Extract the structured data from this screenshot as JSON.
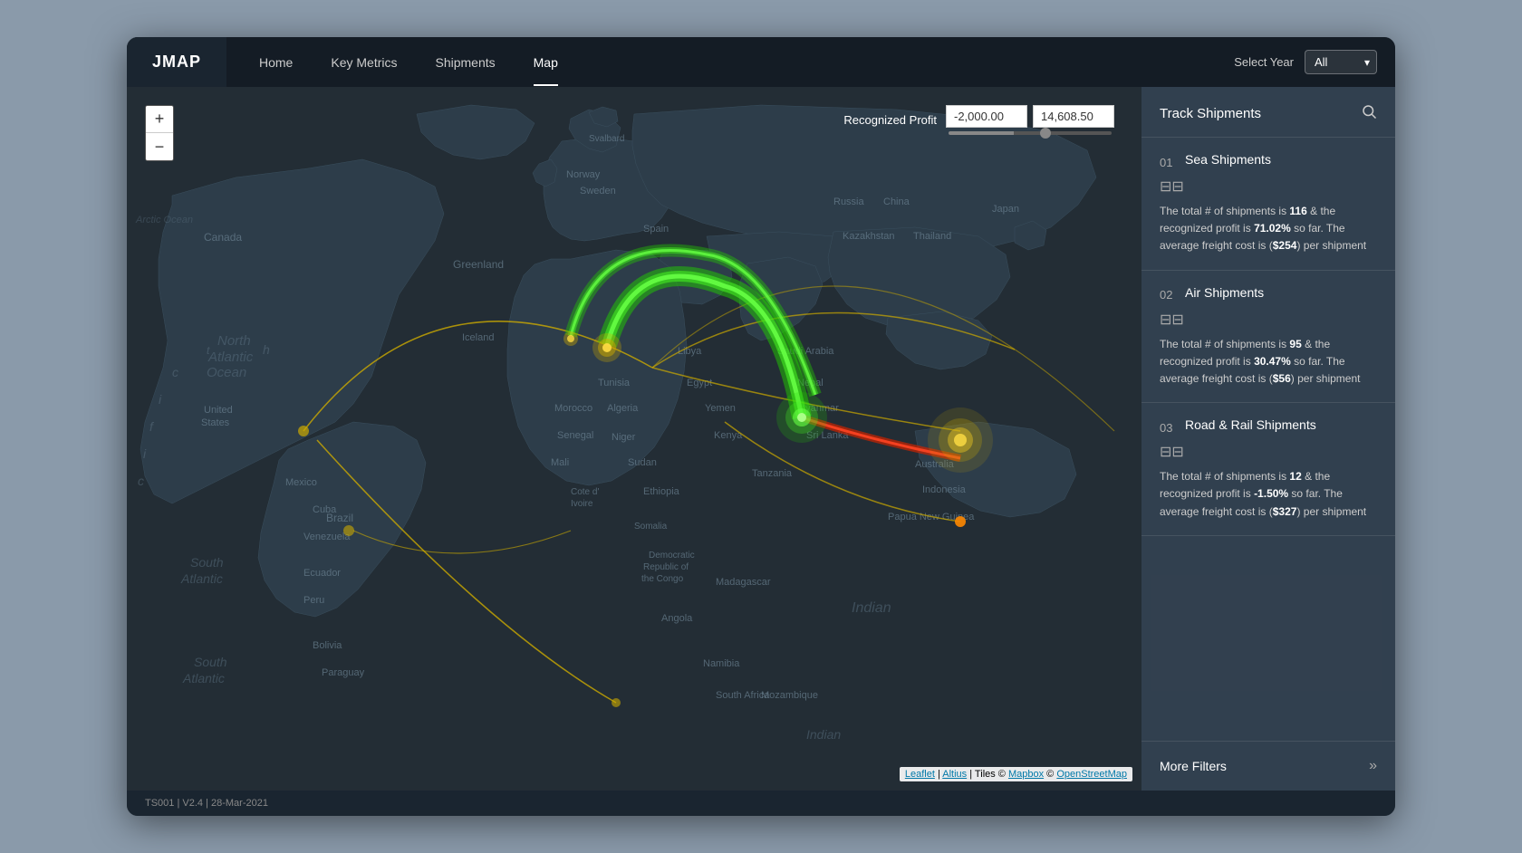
{
  "app": {
    "logo": "JMAP",
    "footer": "TS001 | V2.4 | 28-Mar-2021"
  },
  "nav": {
    "items": [
      {
        "label": "Home",
        "active": false
      },
      {
        "label": "Key Metrics",
        "active": false
      },
      {
        "label": "Shipments",
        "active": false
      },
      {
        "label": "Map",
        "active": true
      }
    ],
    "select_year_label": "Select Year",
    "year_value": "All"
  },
  "map": {
    "zoom_in": "+",
    "zoom_out": "−",
    "profit_label": "Recognized Profit",
    "profit_min": "-2,000.00",
    "profit_max": "14,608.50",
    "attribution": "Leaflet | Altius | Tiles © Mapbox © OpenStreetMap"
  },
  "panel": {
    "title": "Track Shipments",
    "shipments": [
      {
        "number": "01",
        "type": "Sea Shipments",
        "icon": "⊟⊟",
        "description": "The total # of shipments is 116 & the recognized profit is 71.02% so far. The average freight cost is ($254) per shipment"
      },
      {
        "number": "02",
        "type": "Air Shipments",
        "icon": "⊟⊟",
        "description": "The total # of shipments is 95 & the recognized profit is 30.47% so far. The average freight cost is ($56) per shipment"
      },
      {
        "number": "03",
        "type": "Road & Rail Shipments",
        "icon": "⊟⊟",
        "description": "The total # of shipments is 12 & the recognized profit is -1.50% so far. The average freight cost is ($327) per shipment"
      }
    ],
    "more_filters": "More Filters"
  },
  "desc_parts": {
    "sea": {
      "pre1": "The total # of shipments is ",
      "count": "116",
      "mid1": " & the recognized profit is ",
      "pct": "71.02%",
      "mid2": " so far. The average freight cost is (",
      "cost": "$254",
      "post": ") per shipment"
    },
    "air": {
      "pre1": "The total # of shipments is ",
      "count": "95",
      "mid1": " & the recognized profit is ",
      "pct": "30.47%",
      "mid2": " so far. The average freight cost is (",
      "cost": "$56",
      "post": ") per shipment"
    },
    "rail": {
      "pre1": "The total # of shipments is ",
      "count": "12",
      "mid1": " & the recognized profit is ",
      "pct": "-1.50%",
      "mid2": " so far. The average freight cost is (",
      "cost": "$327",
      "post": ") per shipment"
    }
  }
}
